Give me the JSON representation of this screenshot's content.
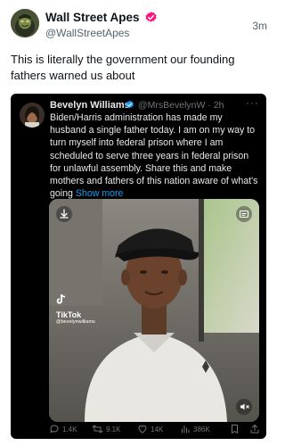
{
  "post": {
    "author_name": "Wall Street Apes",
    "author_handle": "@WallStreetApes",
    "time": "3m",
    "text": "This is literally the government our founding fathers warned us about"
  },
  "quoted": {
    "author_name": "Bevelyn Williams",
    "author_handle": "@MrsBevelynW · 2h",
    "more": "···",
    "text": "Biden/Harris administration has made my husband a single father today. I am on my way to turn myself into federal prison where I am scheduled to serve three years in federal prison for unlawful assembly. Share this and make mothers and fathers of this nation aware of what's going",
    "show_more": "Show more",
    "video": {
      "watermark": "TikTok",
      "watermark_user": "@bevelynwilliams"
    },
    "actions": {
      "replies": "1.4K",
      "reposts": "9.1K",
      "likes": "14K",
      "views": "386K"
    }
  },
  "colors": {
    "accent": "#1d9bf0",
    "card_bg": "#000000",
    "muted": "#71767b"
  },
  "icons": [
    "verified-badge-icon",
    "download-icon",
    "captions-icon",
    "mute-icon",
    "tiktok-logo-icon",
    "reply-icon",
    "repost-icon",
    "like-icon",
    "views-icon",
    "bookmark-icon",
    "share-icon"
  ]
}
